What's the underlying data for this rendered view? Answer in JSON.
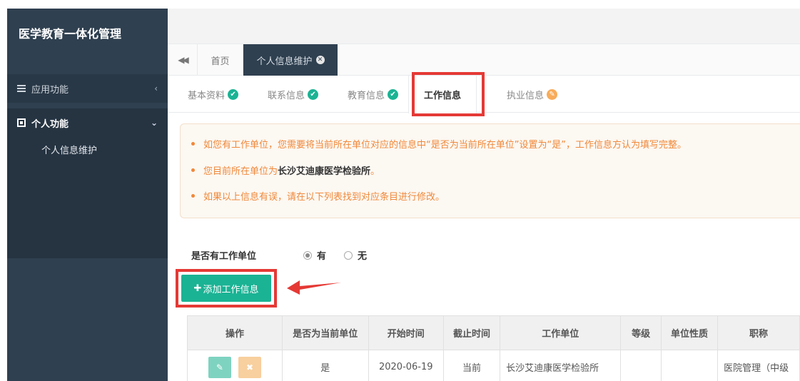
{
  "sidebar": {
    "brand": "医学教育一体化管理",
    "section": {
      "label": "应用功能",
      "chevron": "‹"
    },
    "group": {
      "label": "个人功能",
      "chevron": "⌄",
      "items": [
        {
          "label": "个人信息维护"
        }
      ]
    }
  },
  "page_tabs": {
    "back_icon": "◀◀",
    "home": "首页",
    "active": "个人信息维护",
    "close_icon": "✕"
  },
  "sub_tabs": [
    {
      "label": "基本资料",
      "status": "ok"
    },
    {
      "label": "联系信息",
      "status": "ok"
    },
    {
      "label": "教育信息",
      "status": "ok"
    },
    {
      "label": "工作信息",
      "status": "active"
    },
    {
      "label": "执业信息",
      "status": "edit"
    }
  ],
  "alert": {
    "line1": "如您有工作单位，您需要将当前所在单位对应的信息中“是否为当前所在单位”设置为“是”，工作信息方认为填写完整。",
    "line2_prefix": "您目前所在单位为",
    "line2_unit": "长沙艾迪康医学检验所",
    "line2_suffix": "。",
    "line3": "如果以上信息有误，请在以下列表找到对应条目进行修改。"
  },
  "form": {
    "label": "是否有工作单位",
    "options": [
      {
        "label": "有",
        "selected": true
      },
      {
        "label": "无",
        "selected": false
      }
    ]
  },
  "add_button": {
    "plus": "✚",
    "label": "添加工作信息"
  },
  "table": {
    "headers": [
      "操作",
      "是否为当前单位",
      "开始时间",
      "截止时间",
      "工作单位",
      "等级",
      "单位性质",
      "职称"
    ],
    "rows": [
      {
        "is_current": "是",
        "start": "2020-06-19",
        "end": "当前",
        "unit": "长沙艾迪康医学检验所",
        "level": "",
        "nature": "",
        "title": "医院管理（中级"
      }
    ]
  },
  "icons": {
    "ok": "✔",
    "edit": "✎",
    "delete": "✖"
  },
  "colors": {
    "sidebar": "#2f4050",
    "primary": "#1ab394",
    "warning": "#f8ac59",
    "highlight": "#e53935"
  }
}
